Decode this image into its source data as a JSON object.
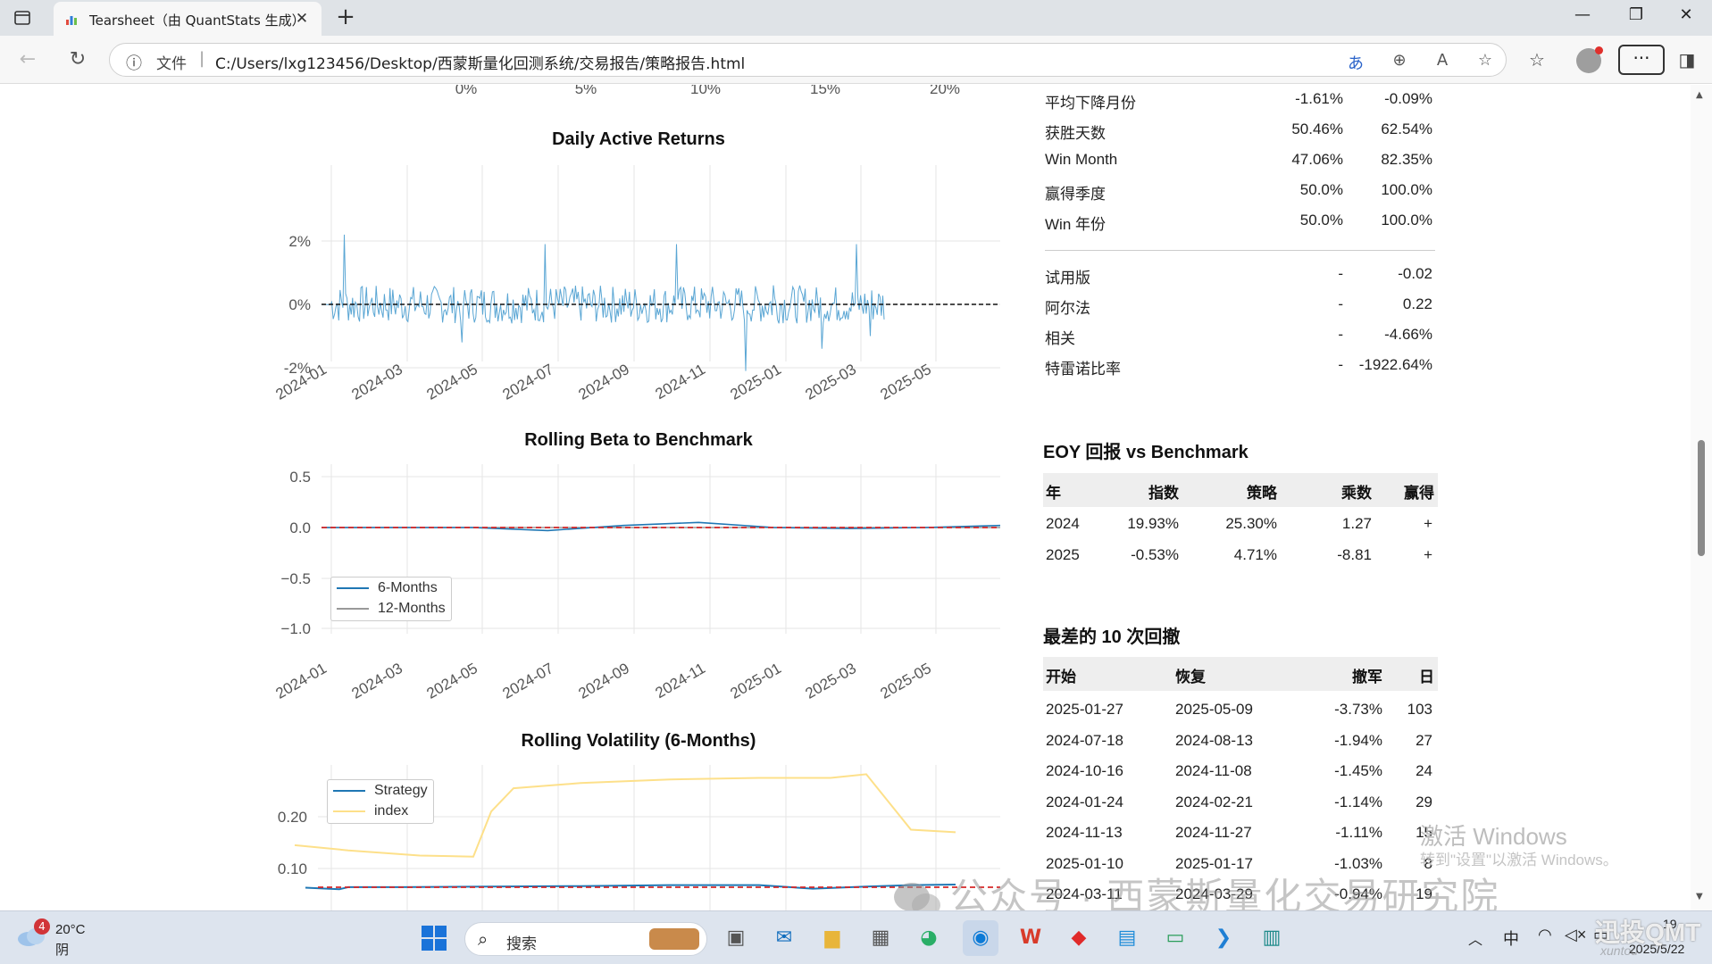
{
  "browser": {
    "tab_title": "Tearsheet（由 QuantStats 生成）",
    "tab_close": "✕",
    "new_tab": "+",
    "scheme_label": "文件",
    "url": "C:/Users/lxg123456/Desktop/西蒙斯量化回测系统/交易报告/策略报告.html"
  },
  "top_axis": {
    "ticks": [
      "0%",
      "5%",
      "10%",
      "15%",
      "20%"
    ]
  },
  "charts": {
    "daily_active": {
      "title": "Daily Active Returns",
      "yticks": [
        "2%",
        "0%",
        "-2%"
      ],
      "xticks": [
        "2024-01",
        "2024-03",
        "2024-05",
        "2024-07",
        "2024-09",
        "2024-11",
        "2025-01",
        "2025-03",
        "2025-05"
      ]
    },
    "rolling_beta": {
      "title": "Rolling Beta to Benchmark",
      "yticks": [
        "0.5",
        "0.0",
        "−0.5",
        "−1.0"
      ],
      "xticks": [
        "2024-01",
        "2024-03",
        "2024-05",
        "2024-07",
        "2024-09",
        "2024-11",
        "2025-01",
        "2025-03",
        "2025-05"
      ],
      "legend": [
        "6-Months",
        "12-Months"
      ]
    },
    "rolling_vol": {
      "title": "Rolling Volatility (6-Months)",
      "yticks": [
        "0.20",
        "0.10"
      ],
      "legend": [
        "Strategy",
        "index"
      ]
    }
  },
  "chart_data": [
    {
      "type": "line",
      "title": "Daily Active Returns",
      "x": [
        "2024-01",
        "2024-03",
        "2024-05",
        "2024-07",
        "2024-09",
        "2024-11",
        "2025-01",
        "2025-03",
        "2025-05"
      ],
      "ylim": [
        -0.025,
        0.025
      ],
      "series": [
        {
          "values": [
            0.0,
            0.022,
            -0.012,
            -0.01,
            0.019,
            -0.008,
            -0.021,
            0.006,
            0.019,
            -0.01
          ]
        }
      ],
      "grid": true
    },
    {
      "type": "line",
      "title": "Rolling Beta to Benchmark",
      "x": [
        "2024-01",
        "2024-03",
        "2024-05",
        "2024-07",
        "2024-09",
        "2024-11",
        "2025-01",
        "2025-03",
        "2025-05"
      ],
      "ylim": [
        -1.0,
        0.5
      ],
      "series": [
        {
          "name": "6-Months",
          "values": [
            0.0,
            0.0,
            0.0,
            -0.03,
            0.02,
            0.05,
            0.0,
            -0.01,
            0.0,
            0.02
          ]
        },
        {
          "name": "12-Months",
          "values": [
            0.0,
            0.0,
            0.0,
            0.0,
            0.0,
            0.0,
            0.0,
            0.0,
            0.0,
            0.0
          ]
        }
      ],
      "legend": "bottom-left",
      "grid": true
    },
    {
      "type": "line",
      "title": "Rolling Volatility (6-Months)",
      "series": [
        {
          "name": "Strategy",
          "values": [
            0.063,
            0.06,
            0.064,
            0.064,
            0.065,
            0.066,
            0.068,
            0.068,
            0.061,
            0.065,
            0.068,
            0.069
          ]
        },
        {
          "name": "index",
          "values": [
            0.145,
            0.135,
            0.125,
            0.123,
            0.21,
            0.255,
            0.265,
            0.272,
            0.275,
            0.275,
            0.282,
            0.175,
            0.17
          ]
        }
      ],
      "legend": "top-left",
      "grid": true
    }
  ],
  "stats": [
    {
      "label": "平均下降月份",
      "v1": "-1.61%",
      "v2": "-0.09%"
    },
    {
      "label": "获胜天数",
      "v1": "50.46%",
      "v2": "62.54%"
    },
    {
      "label": "Win Month",
      "v1": "47.06%",
      "v2": "82.35%"
    },
    {
      "label": "赢得季度",
      "v1": "50.0%",
      "v2": "100.0%"
    },
    {
      "label": "Win 年份",
      "v1": "50.0%",
      "v2": "100.0%"
    }
  ],
  "stats2": [
    {
      "label": "试用版",
      "v1": "-",
      "v2": "-0.02"
    },
    {
      "label": "阿尔法",
      "v1": "-",
      "v2": "0.22"
    },
    {
      "label": "相关",
      "v1": "-",
      "v2": "-4.66%"
    },
    {
      "label": "特雷诺比率",
      "v1": "-",
      "v2": "-1922.64%"
    }
  ],
  "eoy": {
    "title": "EOY 回报 vs Benchmark",
    "headers": [
      "年",
      "指数",
      "策略",
      "乘数",
      "赢得"
    ],
    "rows": [
      [
        "2024",
        "19.93%",
        "25.30%",
        "1.27",
        "+"
      ],
      [
        "2025",
        "-0.53%",
        "4.71%",
        "-8.81",
        "+"
      ]
    ]
  },
  "drawdowns": {
    "title": "最差的 10 次回撤",
    "headers": [
      "开始",
      "恢复",
      "撤军",
      "日"
    ],
    "rows": [
      [
        "2025-01-27",
        "2025-05-09",
        "-3.73%",
        "103"
      ],
      [
        "2024-07-18",
        "2024-08-13",
        "-1.94%",
        "27"
      ],
      [
        "2024-10-16",
        "2024-11-08",
        "-1.45%",
        "24"
      ],
      [
        "2024-01-24",
        "2024-02-21",
        "-1.14%",
        "29"
      ],
      [
        "2024-11-13",
        "2024-11-27",
        "-1.11%",
        "15"
      ],
      [
        "2025-01-10",
        "2025-01-17",
        "-1.03%",
        "8"
      ],
      [
        "2024-03-11",
        "2024-03-29",
        "-0.94%",
        "19"
      ]
    ]
  },
  "watermarks": {
    "activate_title": "激活 Windows",
    "activate_sub": "转到\"设置\"以激活 Windows。",
    "wechat": "公众号 · 西蒙斯量化交易研究院",
    "brand": "迅投QMT",
    "brand_sub": "xuntou"
  },
  "taskbar": {
    "weather_temp": "20°C",
    "weather_desc": "阴",
    "weather_badge": "4",
    "search_placeholder": "搜索",
    "ime": "中",
    "time": "19",
    "date": "2025/5/22"
  },
  "colors": {
    "strategy_blue": "#1f77b4",
    "index_yellow": "#fde08a",
    "ref_red": "#d62728",
    "grid": "#e6e6e6"
  }
}
